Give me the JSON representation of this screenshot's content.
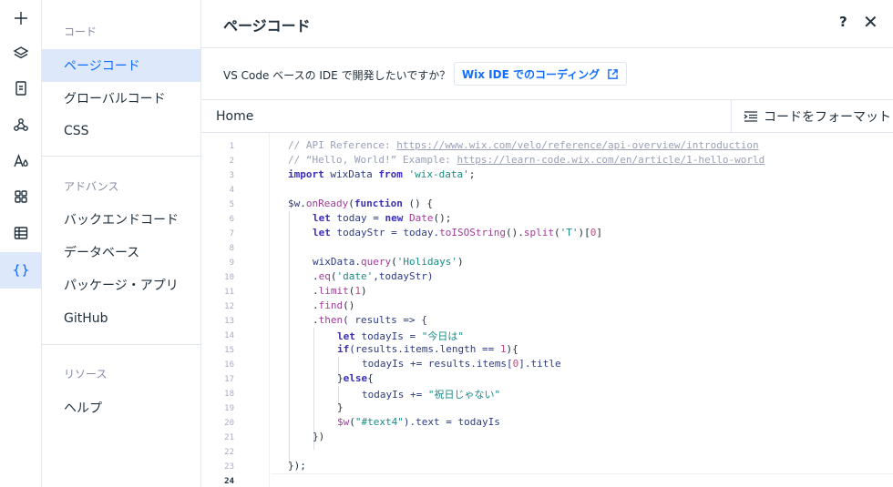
{
  "rail": {
    "icons": [
      "plus-icon",
      "layers-icon",
      "page-icon",
      "connect-icon",
      "theme-icon",
      "apps-icon",
      "table-icon",
      "code-braces-icon"
    ]
  },
  "nav": {
    "section_code": "コード",
    "page_code": "ページコード",
    "global_code": "グローバルコード",
    "css": "CSS",
    "section_advanced": "アドバンス",
    "backend_code": "バックエンドコード",
    "database": "データベース",
    "packages_apps": "パッケージ・アプリ",
    "github": "GitHub",
    "section_resources": "リソース",
    "help": "ヘルプ"
  },
  "header": {
    "title": "ページコード",
    "help_label": "?",
    "close_label": "✕"
  },
  "ide": {
    "prompt": "VS Code ベースの IDE で開発したいですか？",
    "button_label": "Wix IDE でのコーディング"
  },
  "file_bar": {
    "file_name": "Home",
    "format_label": "コードをフォーマット"
  },
  "editor": {
    "line_numbers": [
      "1",
      "2",
      "3",
      "4",
      "5",
      "6",
      "7",
      "8",
      "9",
      "10",
      "11",
      "12",
      "13",
      "14",
      "15",
      "16",
      "17",
      "18",
      "19",
      "20",
      "21",
      "22",
      "23",
      "24"
    ],
    "current_line": "24",
    "code": {
      "l1_comment": "// API Reference: ",
      "l1_url": "https://www.wix.com/velo/reference/api-overview/introduction",
      "l2_comment": "// “Hello, World!” Example: ",
      "l2_url": "https://learn-code.wix.com/en/article/1-hello-world",
      "l3_import": "import",
      "l3_name": " wixData ",
      "l3_from": "from",
      "l3_sp": " ",
      "l3_str": "'wix-data'",
      "l3_end": ";",
      "l5_obj": "$w",
      "l5_dot": ".",
      "l5_fn": "onReady",
      "l5_p1": "(",
      "l5_kw": "function",
      "l5_rest": " () {",
      "l6_let": "let",
      "l6_var": " today = ",
      "l6_new": "new",
      "l6_sp": " ",
      "l6_fn": "Date",
      "l6_end": "();",
      "l7_let": "let",
      "l7_var": " todayStr = today.",
      "l7_fn1": "toISOString",
      "l7_mid": "().",
      "l7_fn2": "split",
      "l7_p1": "(",
      "l7_str": "'T'",
      "l7_p2": ")[",
      "l7_num": "0",
      "l7_end": "]",
      "l9_obj": "wixData.",
      "l9_fn": "query",
      "l9_p1": "(",
      "l9_str": "'Holidays'",
      "l9_end": ")",
      "l10_dot": ".",
      "l10_fn": "eq",
      "l10_p1": "(",
      "l10_str": "'date'",
      "l10_rest": ",todayStr)",
      "l11_dot": ".",
      "l11_fn": "limit",
      "l11_p1": "(",
      "l11_num": "1",
      "l11_end": ")",
      "l12_dot": ".",
      "l12_fn": "find",
      "l12_end": "()",
      "l13_dot": ".",
      "l13_fn": "then",
      "l13_rest": "( results => {",
      "l14_let": "let",
      "l14_var": " todayIs = ",
      "l14_str": "\"今日は\"",
      "l15_if": "if",
      "l15_rest": "(results.items.length == ",
      "l15_num": "1",
      "l15_end": "){",
      "l16_var": "todayIs += results.items[",
      "l16_num": "0",
      "l16_end": "].title",
      "l17_open": "}",
      "l17_else": "else",
      "l17_close": "{",
      "l18_var": "todayIs += ",
      "l18_str": "\"祝日じゃない\"",
      "l19_brace": "}",
      "l20_fn": "$w",
      "l20_p1": "(",
      "l20_str": "\"#text4\"",
      "l20_rest": ").text = todayIs",
      "l21_end": "})",
      "l23_end": "});"
    }
  }
}
